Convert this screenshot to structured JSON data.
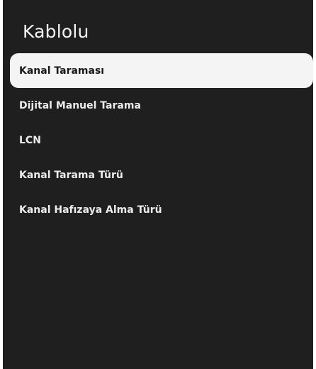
{
  "screen": {
    "title": "Kablolu"
  },
  "menu": {
    "items": [
      {
        "label": "Kanal Taraması",
        "selected": true
      },
      {
        "label": "Dijital Manuel Tarama",
        "selected": false
      },
      {
        "label": "LCN",
        "selected": false
      },
      {
        "label": "Kanal Tarama Türü",
        "selected": false
      },
      {
        "label": "Kanal Hafızaya Alma Türü",
        "selected": false
      }
    ]
  },
  "colors": {
    "background": "#1f1f1f",
    "highlight": "#f4f4f4",
    "text": "#ececec",
    "highlight_text": "#1a1a1a"
  }
}
